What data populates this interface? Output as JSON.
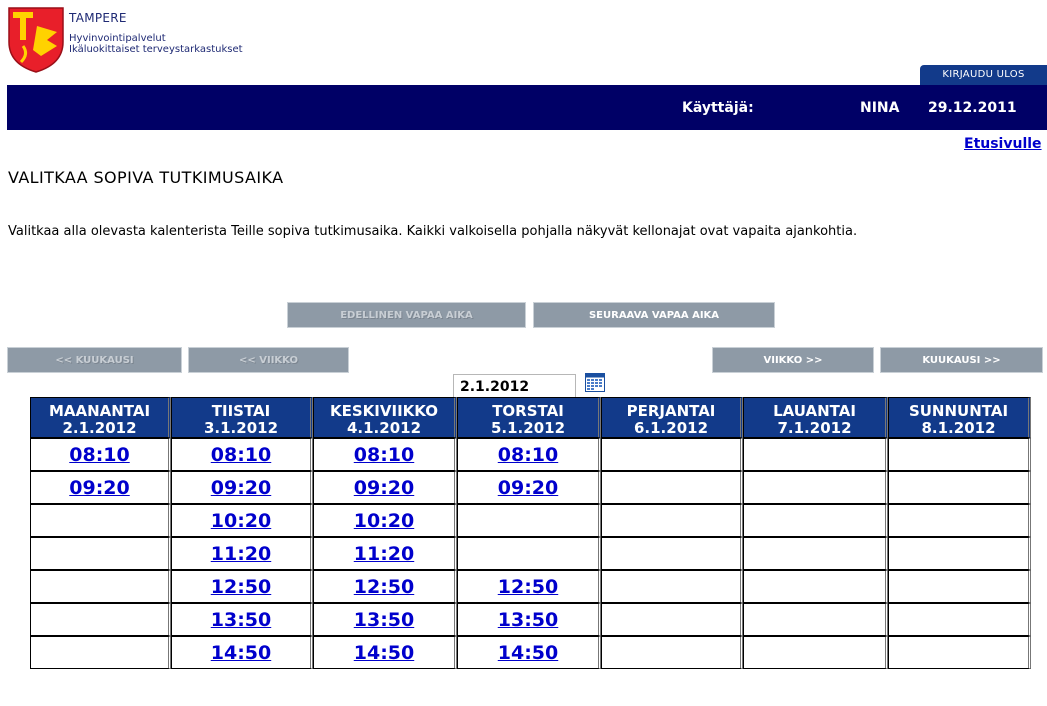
{
  "header": {
    "org_name": "TAMPERE",
    "org_line1": "Hyvinvointipalvelut",
    "org_line2": "Ikäluokittaiset terveystarkastukset",
    "logout_label": "KIRJAUDU ULOS",
    "user_label": "Käyttäjä:",
    "user_name": "NINA",
    "date": "29.12.2011",
    "home_link": "Etusivulle"
  },
  "page": {
    "title": "VALITKAA SOPIVA TUTKIMUSAIKA",
    "intro": "Valitkaa alla olevasta kalenterista Teille sopiva tutkimusaika. Kaikki valkoisella pohjalla näkyvät kellonajat ovat vapaita ajankohtia."
  },
  "nav": {
    "prev_free": "EDELLINEN VAPAA AIKA",
    "next_free": "SEURAAVA VAPAA AIKA",
    "prev_month": "<< KUUKAUSI",
    "prev_week": "<< VIIKKO",
    "current_date": "2.1.2012",
    "next_week": "VIIKKO >>",
    "next_month": "KUUKAUSI >>"
  },
  "calendar": {
    "days": [
      {
        "name": "MAANANTAI",
        "date": "2.1.2012"
      },
      {
        "name": "TIISTAI",
        "date": "3.1.2012"
      },
      {
        "name": "KESKIVIIKKO",
        "date": "4.1.2012"
      },
      {
        "name": "TORSTAI",
        "date": "5.1.2012"
      },
      {
        "name": "PERJANTAI",
        "date": "6.1.2012"
      },
      {
        "name": "LAUANTAI",
        "date": "7.1.2012"
      },
      {
        "name": "SUNNUNTAI",
        "date": "8.1.2012"
      }
    ],
    "rows": [
      [
        "08:10",
        "08:10",
        "08:10",
        "08:10",
        "",
        "",
        ""
      ],
      [
        "09:20",
        "09:20",
        "09:20",
        "09:20",
        "",
        "",
        ""
      ],
      [
        "",
        "10:20",
        "10:20",
        "",
        "",
        "",
        ""
      ],
      [
        "",
        "11:20",
        "11:20",
        "",
        "",
        "",
        ""
      ],
      [
        "",
        "12:50",
        "12:50",
        "12:50",
        "",
        "",
        ""
      ],
      [
        "",
        "13:50",
        "13:50",
        "13:50",
        "",
        "",
        ""
      ],
      [
        "",
        "14:50",
        "14:50",
        "14:50",
        "",
        "",
        ""
      ]
    ]
  },
  "colors": {
    "header_bar": "#000066",
    "table_header": "#123a8a",
    "link": "#0000cc",
    "button": "#8e9aa6"
  }
}
